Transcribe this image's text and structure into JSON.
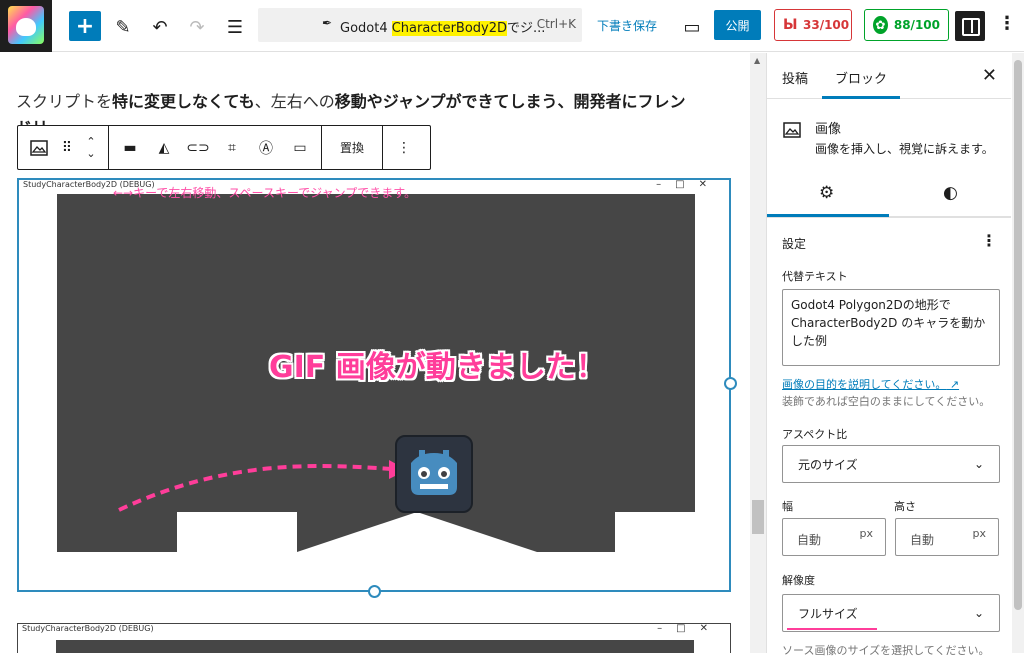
{
  "header": {
    "doc_title_prefix": "Godot4 ",
    "doc_title_highlight": "CharacterBody2D",
    "doc_title_suffix": "でジ...",
    "shortcut": "Ctrl+K",
    "save_draft": "下書き保存",
    "publish": "公開",
    "score_red": "33/100",
    "score_green": "88/100"
  },
  "content": {
    "para1_a": "スクリプトを",
    "para1_b": "特に変更しなくても",
    "para1_c": "、左右への",
    "para1_d": "移動やジャンプができてしまう、開発者にフレン",
    "para2": "ドリ...",
    "toolbar": {
      "replace": "置換"
    },
    "image": {
      "window_title": "StudyCharacterBody2D (DEBUG)",
      "hint": "←→キーで左右移動、スペースキーでジャンプできます。",
      "caption": "GIF 画像が動きました！"
    },
    "image2": {
      "window_title": "StudyCharacterBody2D (DEBUG)"
    }
  },
  "sidebar": {
    "tab_post": "投稿",
    "tab_block": "ブロック",
    "block_title": "画像",
    "block_desc": "画像を挿入し、視覚に訴えます。",
    "settings_title": "設定",
    "alt_label": "代替テキスト",
    "alt_value": "Godot4 Polygon2Dの地形で CharacterBody2D のキャラを動かした例",
    "alt_link": "画像の目的を説明してください。",
    "alt_help": "装飾であれば空白のままにしてください。",
    "aspect_label": "アスペクト比",
    "aspect_value": "元のサイズ",
    "width_label": "幅",
    "height_label": "高さ",
    "width_value": "自動",
    "height_value": "自動",
    "unit": "px",
    "resolution_label": "解像度",
    "resolution_value": "フルサイズ",
    "resolution_help": "ソース画像のサイズを選択してください。"
  },
  "colors": {
    "accent": "#007cba",
    "score_red": "#d63638",
    "score_green": "#00a32a",
    "caption_pink": "#ff3d9a"
  }
}
